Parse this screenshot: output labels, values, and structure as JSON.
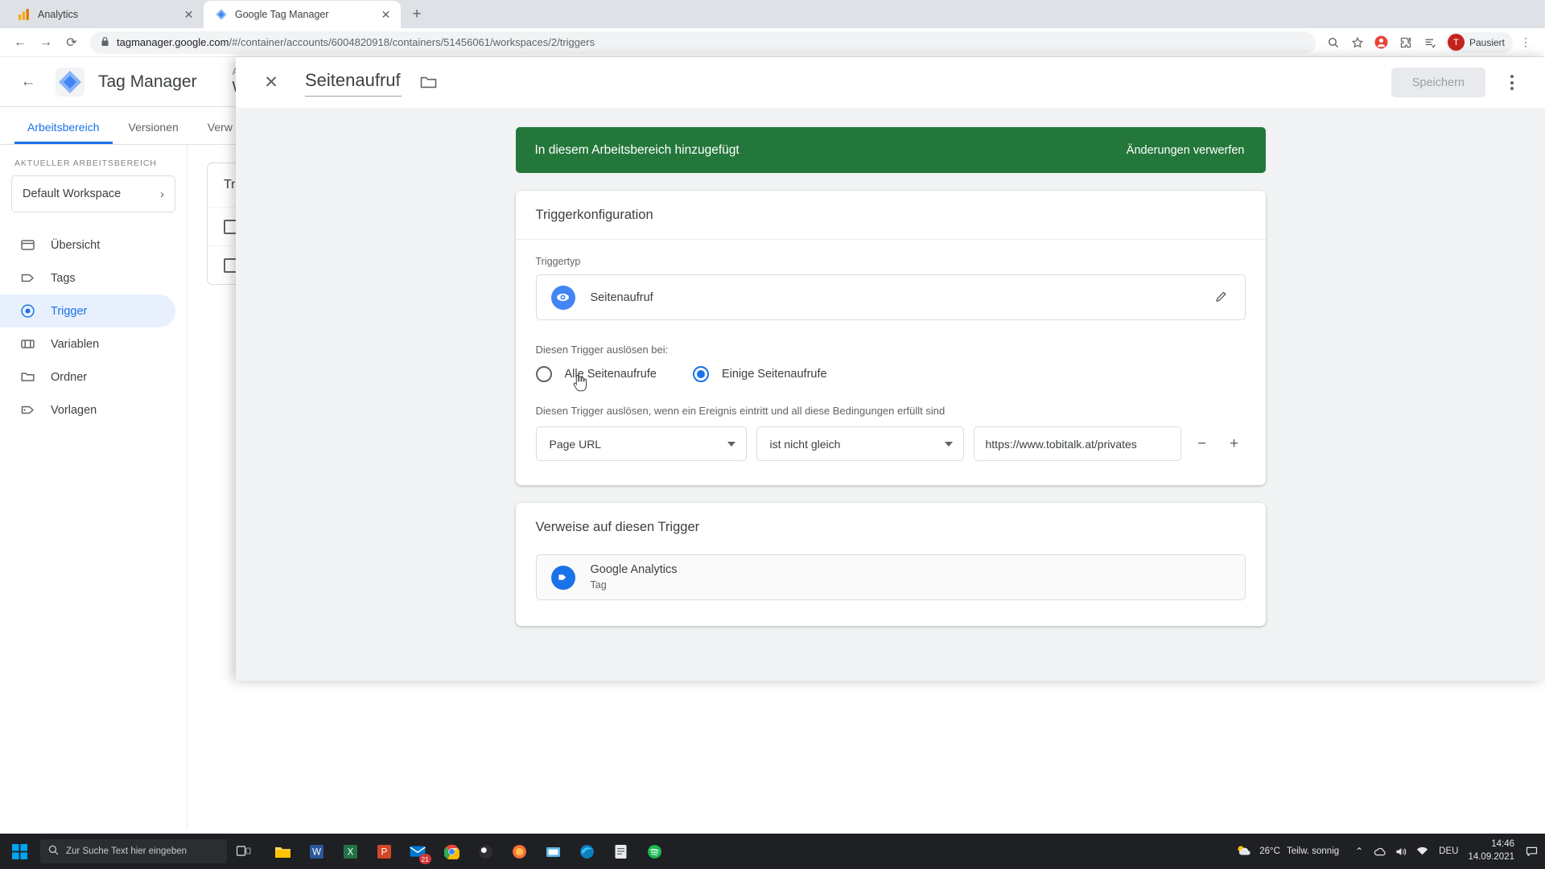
{
  "browser": {
    "tabs": [
      {
        "title": "Analytics",
        "favicon": "analytics-icon",
        "active": false
      },
      {
        "title": "Google Tag Manager",
        "favicon": "tag-manager-icon",
        "active": true
      }
    ],
    "new_tab_label": "+",
    "nav": {
      "back": "←",
      "forward": "→",
      "reload": "⟳"
    },
    "omnibox": {
      "lock_icon": "lock-icon",
      "host": "tagmanager.google.com",
      "path": "/#/container/accounts/6004820918/containers/51456061/workspaces/2/triggers",
      "zoom_icon": "zoom-icon",
      "bookmark_icon": "star-icon"
    },
    "toolbar_icons": [
      "extension-puzzle-icon",
      "reading-list-icon"
    ],
    "profile": {
      "initial": "T",
      "label": "Pausiert"
    },
    "menu_icon": "kebab-menu-icon"
  },
  "gtm": {
    "back_label": "←",
    "brand": "Tag Manager",
    "account_label": "Alle Ko",
    "container_name": "We",
    "tabs": [
      {
        "label": "Arbeitsbereich",
        "active": true
      },
      {
        "label": "Versionen",
        "active": false
      },
      {
        "label": "Verw",
        "active": false
      }
    ],
    "sidebar": {
      "caption": "AKTUELLER ARBEITSBEREICH",
      "workspace": "Default Workspace",
      "items": [
        {
          "label": "Übersicht",
          "icon": "overview-icon",
          "active": false
        },
        {
          "label": "Tags",
          "icon": "tag-icon",
          "active": false
        },
        {
          "label": "Trigger",
          "icon": "trigger-icon",
          "active": true
        },
        {
          "label": "Variablen",
          "icon": "variables-icon",
          "active": false
        },
        {
          "label": "Ordner",
          "icon": "folder-icon",
          "active": false
        },
        {
          "label": "Vorlagen",
          "icon": "templates-icon",
          "active": false
        }
      ]
    },
    "list_title": "Tri"
  },
  "modal": {
    "close_icon": "close-icon",
    "title": "Seitenaufruf",
    "folder_icon": "folder-icon",
    "save_label": "Speichern",
    "menu_icon": "kebab-menu-icon",
    "banner": {
      "message": "In diesem Arbeitsbereich hinzugefügt",
      "action": "Änderungen verwerfen",
      "color": "#24773a"
    },
    "config": {
      "card_title": "Triggerkonfiguration",
      "type_label": "Triggertyp",
      "type_name": "Seitenaufruf",
      "type_icon": "eye-icon",
      "type_icon_color": "#4285f4",
      "edit_icon": "pencil-icon",
      "fire_on_label": "Diesen Trigger auslösen bei:",
      "radios": [
        {
          "label": "Alle Seitenaufrufe",
          "selected": false
        },
        {
          "label": "Einige Seitenaufrufe",
          "selected": true
        }
      ],
      "condition_label": "Diesen Trigger auslösen, wenn ein Ereignis eintritt und all diese Bedingungen erfüllt sind",
      "condition": {
        "variable": "Page URL",
        "operator": "ist nicht gleich",
        "value": "https://www.tobitalk.at/privates",
        "remove_label": "−",
        "add_label": "+"
      }
    },
    "references": {
      "card_title": "Verweise auf diesen Trigger",
      "items": [
        {
          "name": "Google Analytics",
          "type": "Tag",
          "icon": "tag-icon",
          "icon_color": "#1a73e8"
        }
      ]
    }
  },
  "taskbar": {
    "start_icon": "windows-start-icon",
    "search_placeholder": "Zur Suche Text hier eingeben",
    "search_icon": "search-icon",
    "taskview_icon": "task-view-icon",
    "apps": [
      {
        "name": "file-explorer-icon",
        "badge": ""
      },
      {
        "name": "word-icon",
        "badge": ""
      },
      {
        "name": "excel-icon",
        "badge": ""
      },
      {
        "name": "powerpoint-icon",
        "badge": ""
      },
      {
        "name": "mail-icon",
        "badge": "21"
      },
      {
        "name": "chrome-icon",
        "badge": ""
      },
      {
        "name": "obs-icon",
        "badge": ""
      },
      {
        "name": "firefox-icon",
        "badge": ""
      },
      {
        "name": "snipping-tool-icon",
        "badge": ""
      },
      {
        "name": "edge-icon",
        "badge": ""
      },
      {
        "name": "notepad-icon",
        "badge": ""
      },
      {
        "name": "spotify-icon",
        "badge": ""
      }
    ],
    "weather": {
      "temp": "26°C",
      "desc": "Teilw. sonnig",
      "icon": "partly-cloudy-icon"
    },
    "tray_icons": [
      "chevron-up-icon",
      "onedrive-icon",
      "volume-icon",
      "network-icon"
    ],
    "keyboard": "DEU",
    "time": "14:46",
    "date": "14.09.2021",
    "notification_icon": "notification-icon"
  }
}
